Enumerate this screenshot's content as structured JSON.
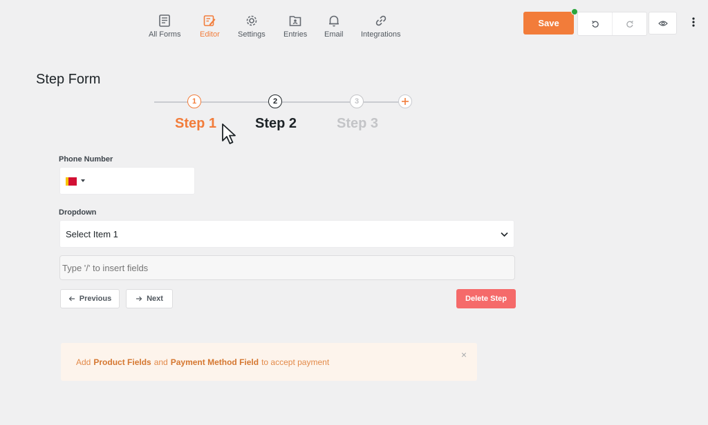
{
  "nav": {
    "items": [
      {
        "label": "All Forms",
        "icon": "forms-icon"
      },
      {
        "label": "Editor",
        "icon": "edit-icon"
      },
      {
        "label": "Settings",
        "icon": "gear-icon"
      },
      {
        "label": "Entries",
        "icon": "entries-icon"
      },
      {
        "label": "Email",
        "icon": "bell-icon"
      },
      {
        "label": "Integrations",
        "icon": "link-icon"
      }
    ],
    "active": "Editor",
    "accent_color": "#f27c3a"
  },
  "toolbar": {
    "save_label": "Save",
    "status_color": "#2ba53c"
  },
  "form": {
    "title": "Step Form",
    "steps": [
      {
        "number": "1",
        "label": "Step 1",
        "state": "active",
        "color": "#f27c3a"
      },
      {
        "number": "2",
        "label": "Step 2",
        "state": "current",
        "color": "#1d2327"
      },
      {
        "number": "3",
        "label": "Step 3",
        "state": "inactive",
        "color": "#c3c4c7"
      }
    ],
    "phone": {
      "label": "Phone Number"
    },
    "dropdown": {
      "label": "Dropdown",
      "selected": "Select Item 1"
    },
    "insert_placeholder": "Type '/' to insert fields",
    "previous_label": "Previous",
    "next_label": "Next",
    "delete_label": "Delete Step"
  },
  "notice": {
    "prefix": "Add",
    "product_fields": "Product Fields",
    "and": "and",
    "payment_field": "Payment Method Field",
    "suffix": "to accept payment",
    "close": "×"
  }
}
